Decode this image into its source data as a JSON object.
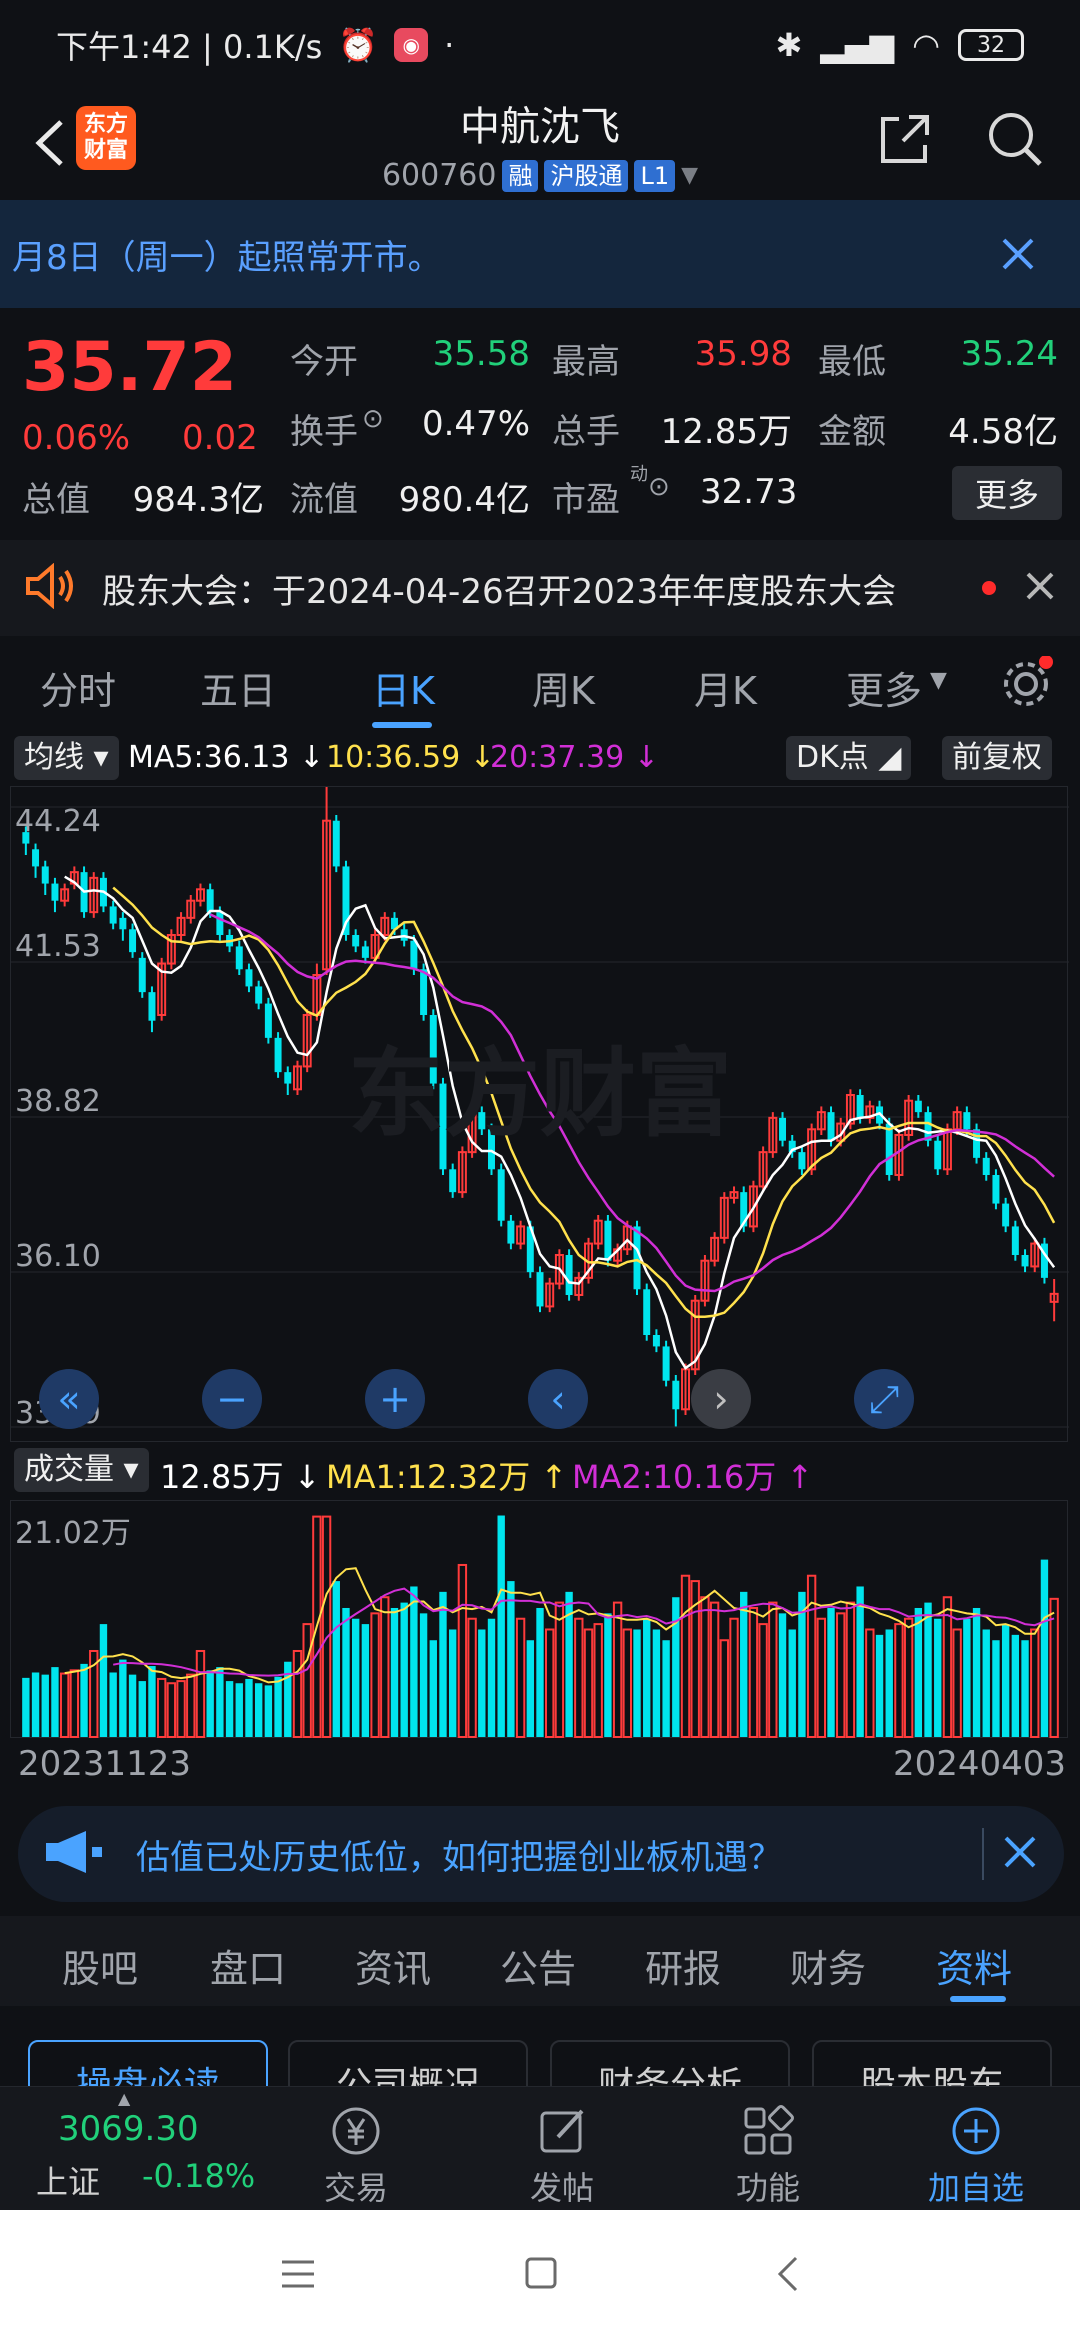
{
  "status_bar": {
    "time": "下午1:42 | 0.1K/s",
    "battery": "32"
  },
  "header": {
    "stock_name": "中航沈飞",
    "stock_code": "600760",
    "tags": [
      "融",
      "沪股通",
      "L1"
    ],
    "logo_text": "东方财富"
  },
  "notice": {
    "text": "月8日（周一）起照常开市。"
  },
  "quote": {
    "price": "35.72",
    "change_pct": "0.06%",
    "change_abs": "0.02",
    "labels": {
      "open": "今开",
      "high": "最高",
      "low": "最低",
      "turnover": "换手",
      "volume": "总手",
      "amount": "金额",
      "total_value": "总值",
      "float_value": "流值",
      "pe": "市盈"
    },
    "values": {
      "open": "35.58",
      "high": "35.98",
      "low": "35.24",
      "turnover": "0.47%",
      "volume": "12.85万",
      "amount": "4.58亿",
      "total_value": "984.3亿",
      "float_value": "980.4亿",
      "pe": "32.73"
    },
    "more_label": "更多"
  },
  "event": {
    "text": "股东大会：于2024-04-26召开2023年年度股东大会"
  },
  "chart_tabs": [
    "分时",
    "五日",
    "日K",
    "周K",
    "月K",
    "更多"
  ],
  "ma": {
    "selector": "均线",
    "ma5": "MA5:36.13",
    "ma10": "10:36.59",
    "ma20": "20:37.39",
    "dk": "DK点",
    "adjust": "前复权"
  },
  "volume_header": {
    "selector": "成交量",
    "value": "12.85万",
    "ma1": "MA1:12.32万",
    "ma2": "MA2:10.16万"
  },
  "chart_data": [
    {
      "type": "candlestick",
      "y_ticks": [
        "44.24",
        "41.53",
        "38.82",
        "36.10",
        "33.39"
      ],
      "ylim": [
        33.39,
        44.24
      ],
      "start_date": "20231123",
      "end_date": "20240403",
      "close": [
        43.6,
        43.2,
        42.9,
        42.6,
        42.8,
        43.1,
        42.4,
        43.0,
        42.5,
        42.2,
        42.1,
        41.7,
        41.0,
        40.5,
        41.5,
        42.0,
        42.3,
        42.6,
        42.8,
        42.4,
        42.0,
        41.8,
        41.4,
        41.1,
        40.8,
        40.2,
        39.6,
        39.4,
        39.7,
        40.6,
        41.3,
        44.0,
        43.2,
        42.0,
        41.8,
        41.6,
        42.0,
        42.3,
        42.1,
        41.9,
        41.4,
        40.6,
        39.4,
        37.9,
        37.5,
        38.2,
        38.9,
        38.6,
        37.9,
        37.0,
        36.6,
        36.9,
        36.1,
        35.5,
        35.9,
        36.4,
        35.7,
        36.0,
        36.6,
        37.0,
        36.3,
        36.5,
        36.9,
        35.8,
        35.0,
        34.8,
        34.2,
        33.7,
        34.4,
        35.6,
        36.3,
        36.7,
        37.4,
        37.5,
        36.9,
        37.6,
        38.2,
        38.8,
        38.4,
        38.2,
        37.9,
        38.6,
        38.9,
        38.4,
        38.7,
        39.2,
        38.8,
        39.0,
        38.7,
        37.8,
        38.5,
        39.1,
        38.9,
        38.4,
        37.9,
        38.6,
        38.9,
        38.6,
        38.1,
        37.8,
        37.3,
        36.9,
        36.4,
        36.2,
        36.6,
        36.0,
        35.72
      ],
      "open": [
        43.8,
        43.5,
        43.2,
        42.9,
        42.6,
        42.9,
        43.1,
        42.4,
        43.0,
        42.5,
        42.3,
        42.1,
        41.6,
        41.0,
        40.6,
        41.5,
        42.0,
        42.3,
        42.6,
        42.8,
        42.4,
        42.0,
        41.8,
        41.4,
        41.1,
        40.8,
        40.2,
        39.6,
        39.3,
        39.7,
        40.6,
        41.4,
        44.0,
        43.2,
        42.0,
        41.8,
        41.6,
        42.0,
        42.3,
        42.1,
        41.9,
        41.4,
        40.6,
        39.4,
        37.9,
        37.5,
        38.2,
        38.9,
        38.6,
        37.9,
        37.0,
        36.6,
        36.9,
        36.1,
        35.5,
        35.9,
        36.4,
        35.7,
        36.0,
        36.6,
        37.0,
        36.3,
        36.5,
        36.9,
        35.8,
        35.0,
        34.8,
        34.2,
        33.7,
        34.4,
        35.6,
        36.3,
        36.7,
        37.4,
        37.5,
        36.9,
        37.6,
        38.2,
        38.8,
        38.4,
        38.2,
        37.9,
        38.6,
        38.9,
        38.4,
        38.7,
        39.2,
        38.8,
        39.0,
        38.7,
        37.8,
        38.5,
        39.1,
        38.9,
        38.4,
        37.9,
        38.6,
        38.9,
        38.6,
        38.1,
        37.8,
        37.3,
        36.9,
        36.4,
        36.2,
        36.6,
        35.58
      ],
      "high": [
        43.9,
        43.6,
        43.3,
        43.0,
        42.9,
        43.2,
        43.2,
        43.1,
        43.1,
        42.6,
        42.4,
        42.2,
        41.7,
        41.1,
        41.6,
        42.1,
        42.4,
        42.7,
        42.9,
        42.9,
        42.5,
        42.1,
        41.9,
        41.5,
        41.2,
        40.9,
        40.3,
        39.7,
        39.8,
        40.7,
        41.5,
        44.9,
        44.1,
        43.3,
        42.1,
        41.9,
        42.1,
        42.4,
        42.4,
        42.2,
        42.0,
        41.5,
        40.7,
        39.5,
        38.0,
        38.3,
        39.0,
        39.0,
        38.7,
        38.0,
        37.1,
        37.0,
        37.0,
        36.2,
        36.0,
        36.5,
        36.5,
        36.1,
        36.7,
        37.1,
        37.1,
        36.6,
        37.0,
        37.0,
        35.9,
        35.1,
        34.9,
        34.3,
        34.5,
        35.7,
        36.4,
        36.8,
        37.5,
        37.6,
        37.6,
        37.7,
        38.3,
        38.9,
        38.9,
        38.5,
        38.3,
        38.7,
        39.0,
        39.0,
        38.8,
        39.3,
        39.3,
        39.1,
        39.1,
        38.8,
        38.6,
        39.2,
        39.2,
        39.0,
        38.5,
        38.7,
        39.0,
        39.0,
        38.7,
        38.2,
        37.9,
        37.4,
        37.0,
        36.5,
        36.7,
        36.7,
        35.98
      ],
      "low": [
        43.4,
        43.0,
        42.7,
        42.4,
        42.5,
        42.8,
        42.3,
        42.3,
        42.4,
        42.1,
        41.9,
        41.6,
        40.9,
        40.3,
        40.5,
        41.4,
        41.9,
        42.2,
        42.5,
        42.3,
        41.9,
        41.7,
        41.3,
        41.0,
        40.7,
        40.1,
        39.5,
        39.2,
        39.2,
        39.6,
        40.5,
        41.3,
        43.1,
        41.9,
        41.7,
        41.5,
        41.5,
        41.9,
        42.0,
        41.8,
        41.3,
        40.5,
        39.3,
        37.8,
        37.4,
        37.4,
        38.1,
        38.5,
        37.8,
        36.9,
        36.5,
        36.5,
        36.0,
        35.4,
        35.4,
        35.8,
        35.6,
        35.6,
        35.9,
        36.5,
        36.2,
        36.2,
        36.4,
        35.7,
        34.9,
        34.7,
        34.1,
        33.4,
        33.6,
        34.3,
        35.5,
        36.2,
        36.6,
        37.3,
        36.8,
        36.8,
        37.5,
        38.1,
        38.3,
        38.1,
        37.8,
        37.8,
        38.5,
        38.3,
        38.3,
        38.6,
        38.7,
        38.7,
        38.6,
        37.7,
        37.7,
        38.4,
        38.8,
        38.3,
        37.8,
        37.8,
        38.5,
        38.5,
        38.0,
        37.7,
        37.2,
        36.8,
        36.3,
        36.1,
        36.1,
        35.9,
        35.24
      ]
    },
    {
      "type": "bar",
      "title": "成交量",
      "y_ticks": [
        "21.02万"
      ],
      "volumes": [
        5.5,
        6.0,
        5.8,
        6.5,
        5.9,
        6.2,
        6.8,
        8.0,
        10.5,
        6.0,
        7.2,
        5.8,
        5.2,
        6.6,
        5.4,
        5.0,
        5.2,
        5.8,
        8.0,
        6.2,
        6.5,
        5.2,
        5.0,
        5.4,
        5.0,
        4.8,
        5.6,
        7.0,
        8.0,
        10.5,
        20.5,
        20.5,
        14.5,
        12.0,
        11.0,
        10.5,
        11.5,
        13.0,
        12.0,
        12.5,
        14.0,
        11.5,
        9.0,
        13.5,
        10.0,
        16.0,
        11.0,
        10.0,
        11.0,
        20.6,
        14.5,
        11.0,
        9.0,
        12.0,
        10.0,
        12.5,
        13.5,
        11.0,
        10.0,
        10.5,
        11.5,
        12.5,
        10.0,
        10.0,
        11.0,
        10.0,
        9.0,
        13.0,
        15.0,
        14.5,
        13.0,
        12.5,
        9.0,
        11.0,
        13.5,
        12.0,
        10.5,
        12.5,
        11.5,
        10.0,
        13.5,
        15.0,
        11.0,
        12.0,
        11.5,
        12.5,
        14.0,
        10.0,
        9.5,
        10.0,
        10.5,
        11.0,
        12.0,
        12.5,
        11.0,
        13.0,
        10.0,
        11.0,
        12.0,
        10.0,
        9.0,
        10.5,
        9.5,
        9.0,
        10.0,
        16.5,
        12.85
      ]
    }
  ],
  "promo": {
    "text": "估值已处历史低位，如何把握创业板机遇？"
  },
  "info_tabs": [
    "股吧",
    "盘口",
    "资讯",
    "公告",
    "研报",
    "财务",
    "资料"
  ],
  "chips": [
    "操盘必读",
    "公司概况",
    "财务分析",
    "股本股东"
  ],
  "bottom_nav": {
    "index_value": "3069.30",
    "index_name": "上证",
    "index_change": "-0.18%",
    "items": [
      "交易",
      "发帖",
      "功能",
      "加自选"
    ]
  },
  "colors": {
    "up": "#ff3b3b",
    "down": "#21d07a",
    "candle_down": "#00e5ee",
    "accent": "#4aa3ff",
    "ma5": "#ffffff",
    "ma10": "#ffe14d",
    "ma20": "#d12fd6"
  }
}
